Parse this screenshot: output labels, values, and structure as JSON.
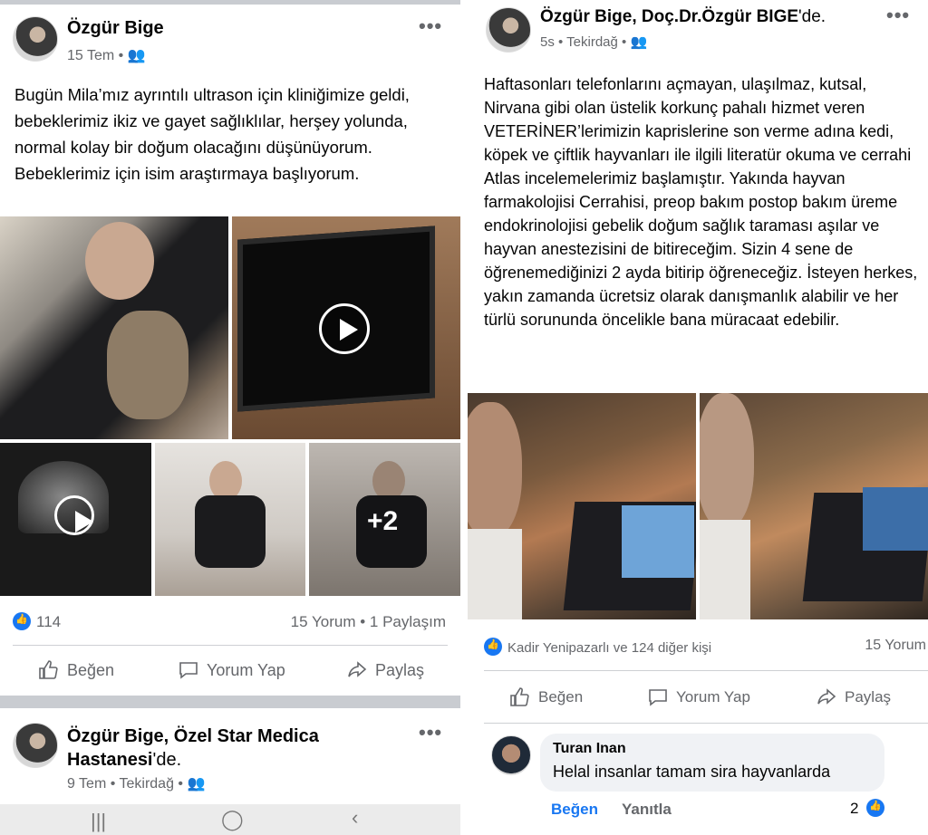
{
  "left": {
    "post1": {
      "author": "Özgür Bige",
      "date": "15 Tem",
      "text": "Bugün Mila’mız ayrıntılı ultrason için kliniğimize geldi, bebeklerimiz ikiz ve gayet sağlıklılar, herşey yolunda, normal kolay bir doğum olacağını düşünüyorum. Bebeklerimiz için isim araştırmaya başlıyorum.",
      "more_photos": "+2",
      "likes": "114",
      "comments_shares": "15 Yorum • 1 Paylaşım",
      "actions": {
        "like": "Beğen",
        "comment": "Yorum Yap",
        "share": "Paylaş"
      }
    },
    "post2": {
      "author": "Özgür Bige",
      "location_sep": ", ",
      "place": "Özel Star Medica Hastanesi",
      "place_suffix": "'de.",
      "date": "9 Tem • Tekirdağ"
    },
    "nav": {
      "recent": "|||",
      "home": "◯",
      "back": "‹"
    }
  },
  "right": {
    "post": {
      "author": "Özgür Bige",
      "location_sep": ", ",
      "place": "Doç.Dr.Özgür BIGE",
      "place_suffix": "'de.",
      "date": "5s • Tekirdağ",
      "text": "Haftasonları telefonlarını açmayan, ulaşılmaz, kutsal, Nirvana gibi olan üstelik korkunç pahalı hizmet veren VETERİNER’lerimizin kaprislerine son verme adına kedi, köpek ve çiftlik hayvanları ile ilgili literatür okuma ve cerrahi Atlas incelemelerimiz başlamıştır. Yakında hayvan farmakolojisi Cerrahisi, preop bakım postop bakım üreme endokrinolojisi gebelik doğum  sağlık taraması aşılar ve hayvan anestezisini de  bitireceğim. Sizin 4 sene de öğrenemediğinizi 2 ayda bitirip öğreneceğiz. İsteyen herkes, yakın zamanda ücretsiz olarak danışmanlık alabilir  ve her türlü sorununda öncelikle bana müracaat edebilir.",
      "likes": "Kadir Yenipazarlı ve 124 diğer kişi",
      "comments": "15 Yorum",
      "actions": {
        "like": "Beğen",
        "comment": "Yorum Yap",
        "share": "Paylaş"
      }
    },
    "comment": {
      "author": "Turan Inan",
      "text": "Helal insanlar tamam sira hayvanlarda",
      "like": "Beğen",
      "reply": "Yanıtla",
      "reactions": "2"
    }
  },
  "colors": {
    "facebook_blue": "#1877f2",
    "text_gray": "#65676b",
    "divider": "#ced0d4"
  }
}
